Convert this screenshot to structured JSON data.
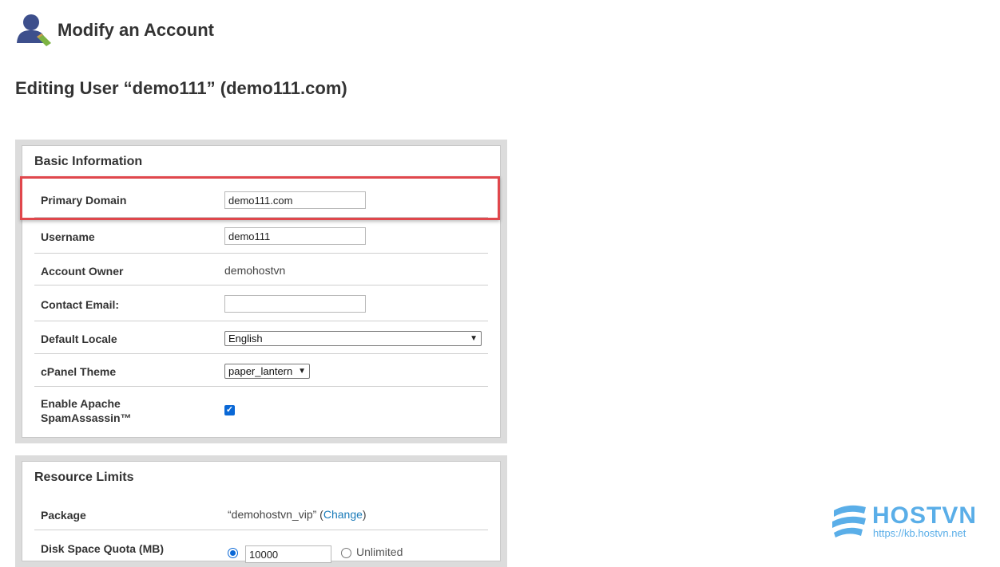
{
  "page": {
    "title": "Modify an Account",
    "subtitle": "Editing User “demo111” (demo111.com)"
  },
  "basic_info": {
    "title": "Basic Information",
    "primary_domain": {
      "label": "Primary Domain",
      "value": "demo111.com"
    },
    "username": {
      "label": "Username",
      "value": "demo111"
    },
    "account_owner": {
      "label": "Account Owner",
      "value": "demohostvn"
    },
    "contact_email": {
      "label": "Contact Email:",
      "value": ""
    },
    "default_locale": {
      "label": "Default Locale",
      "value": "English"
    },
    "cpanel_theme": {
      "label": "cPanel Theme",
      "value": "paper_lantern"
    },
    "spamassassin": {
      "label_line1": "Enable Apache",
      "label_line2": "SpamAssassin™",
      "checked": true
    }
  },
  "resource_limits": {
    "title": "Resource Limits",
    "package": {
      "label": "Package",
      "value": "“demohostvn_vip”",
      "open_paren": " (",
      "change_link": "Change",
      "close_paren": ")"
    },
    "disk_quota": {
      "label": "Disk Space Quota (MB)",
      "value": "10000",
      "unlimited_label": "Unlimited"
    }
  },
  "watermark": {
    "brand": "HOSTVN",
    "url": "https://kb.hostvn.net"
  },
  "colors": {
    "highlight": "#e0474c",
    "link": "#1a7bb9",
    "checkbox": "#0a68d6",
    "brand": "#5aaee8"
  }
}
